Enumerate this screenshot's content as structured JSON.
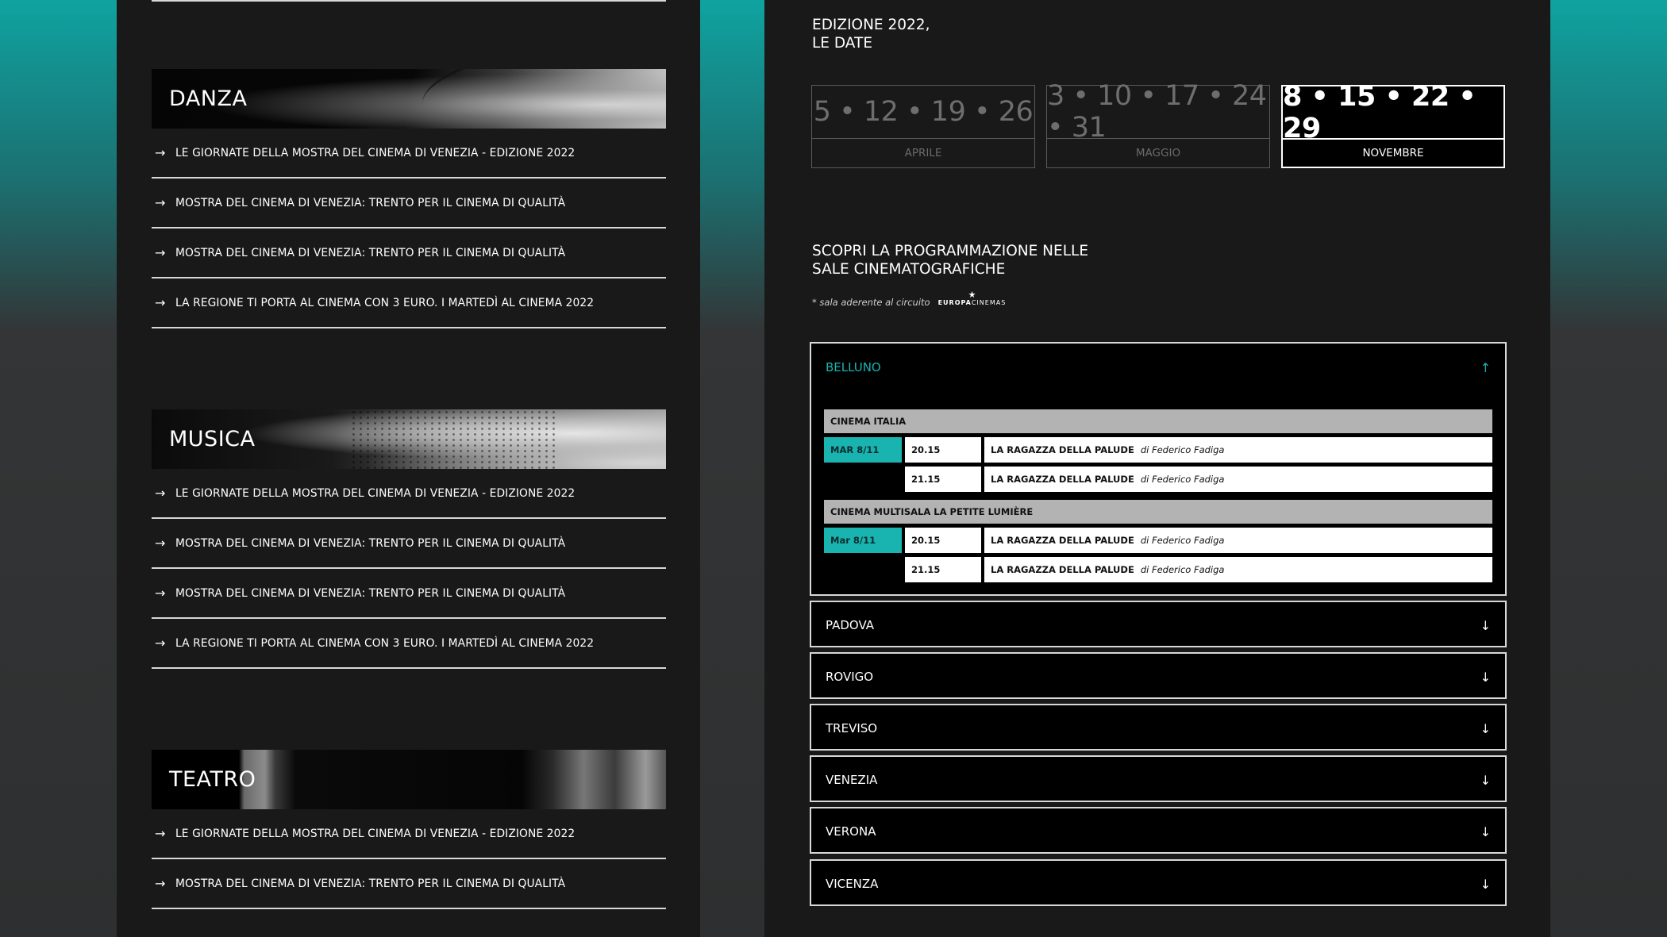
{
  "left": {
    "sections": [
      {
        "title": "DANZA",
        "items": [
          "LE GIORNATE DELLA MOSTRA DEL CINEMA DI VENEZIA - EDIZIONE 2022",
          "MOSTRA DEL CINEMA DI VENEZIA: TRENTO PER IL CINEMA DI QUALITÀ",
          "MOSTRA DEL CINEMA DI VENEZIA: TRENTO PER IL CINEMA DI QUALITÀ",
          "LA REGIONE TI PORTA AL CINEMA CON 3 EURO. I MARTEDÌ AL CINEMA 2022"
        ]
      },
      {
        "title": "MUSICA",
        "items": [
          "LE GIORNATE DELLA MOSTRA DEL CINEMA DI VENEZIA - EDIZIONE 2022",
          "MOSTRA DEL CINEMA DI VENEZIA: TRENTO PER IL CINEMA DI QUALITÀ",
          "MOSTRA DEL CINEMA DI VENEZIA: TRENTO PER IL CINEMA DI QUALITÀ",
          "LA REGIONE TI PORTA AL CINEMA CON 3 EURO. I MARTEDÌ AL CINEMA 2022"
        ]
      },
      {
        "title": "TEATRO",
        "items": [
          "LE GIORNATE DELLA MOSTRA DEL CINEMA DI VENEZIA - EDIZIONE 2022",
          "MOSTRA DEL CINEMA DI VENEZIA: TRENTO PER IL CINEMA DI QUALITÀ"
        ]
      }
    ],
    "arrow_glyph": "→"
  },
  "right": {
    "edition_title": [
      "EDIZIONE 2022,",
      "LE DATE"
    ],
    "dates": [
      {
        "days": "5 • 12 • 19 • 26",
        "month": "APRILE",
        "active": false
      },
      {
        "days": "3 • 10 • 17 • 24 • 31",
        "month": "MAGGIO",
        "active": false
      },
      {
        "days": "8 • 15 • 22 • 29",
        "month": "NOVEMBRE",
        "active": true
      }
    ],
    "discover_title": [
      "SCOPRI LA PROGRAMMAZIONE NELLE",
      "SALE CINEMATOGRAFICHE"
    ],
    "note": "* sala aderente al circuito",
    "europa_logo": {
      "bold": "EUROPA",
      "rest": "CINEMAS",
      "star": "★"
    },
    "open_city": {
      "name": "BELLUNO",
      "chevron": "↑",
      "venues": [
        {
          "name": "CINEMA ITALIA",
          "shows": [
            {
              "day": "MAR 8/11",
              "time": "20.15",
              "film": "LA RAGAZZA DELLA PALUDE",
              "director": "di Federico Fadiga"
            },
            {
              "day": "",
              "time": "21.15",
              "film": "LA RAGAZZA DELLA PALUDE",
              "director": "di Federico Fadiga"
            }
          ]
        },
        {
          "name": "CINEMA MULTISALA LA PETITE LUMIÈRE",
          "shows": [
            {
              "day": "Mar 8/11",
              "time": "20.15",
              "film": "LA RAGAZZA DELLA PALUDE",
              "director": "di Federico Fadiga"
            },
            {
              "day": "",
              "time": "21.15",
              "film": "LA RAGAZZA DELLA PALUDE",
              "director": "di Federico Fadiga"
            }
          ]
        }
      ]
    },
    "closed_cities": [
      "PADOVA",
      "ROVIGO",
      "TREVISO",
      "VENEZIA",
      "VERONA",
      "VICENZA"
    ],
    "closed_chevron": "↓"
  }
}
